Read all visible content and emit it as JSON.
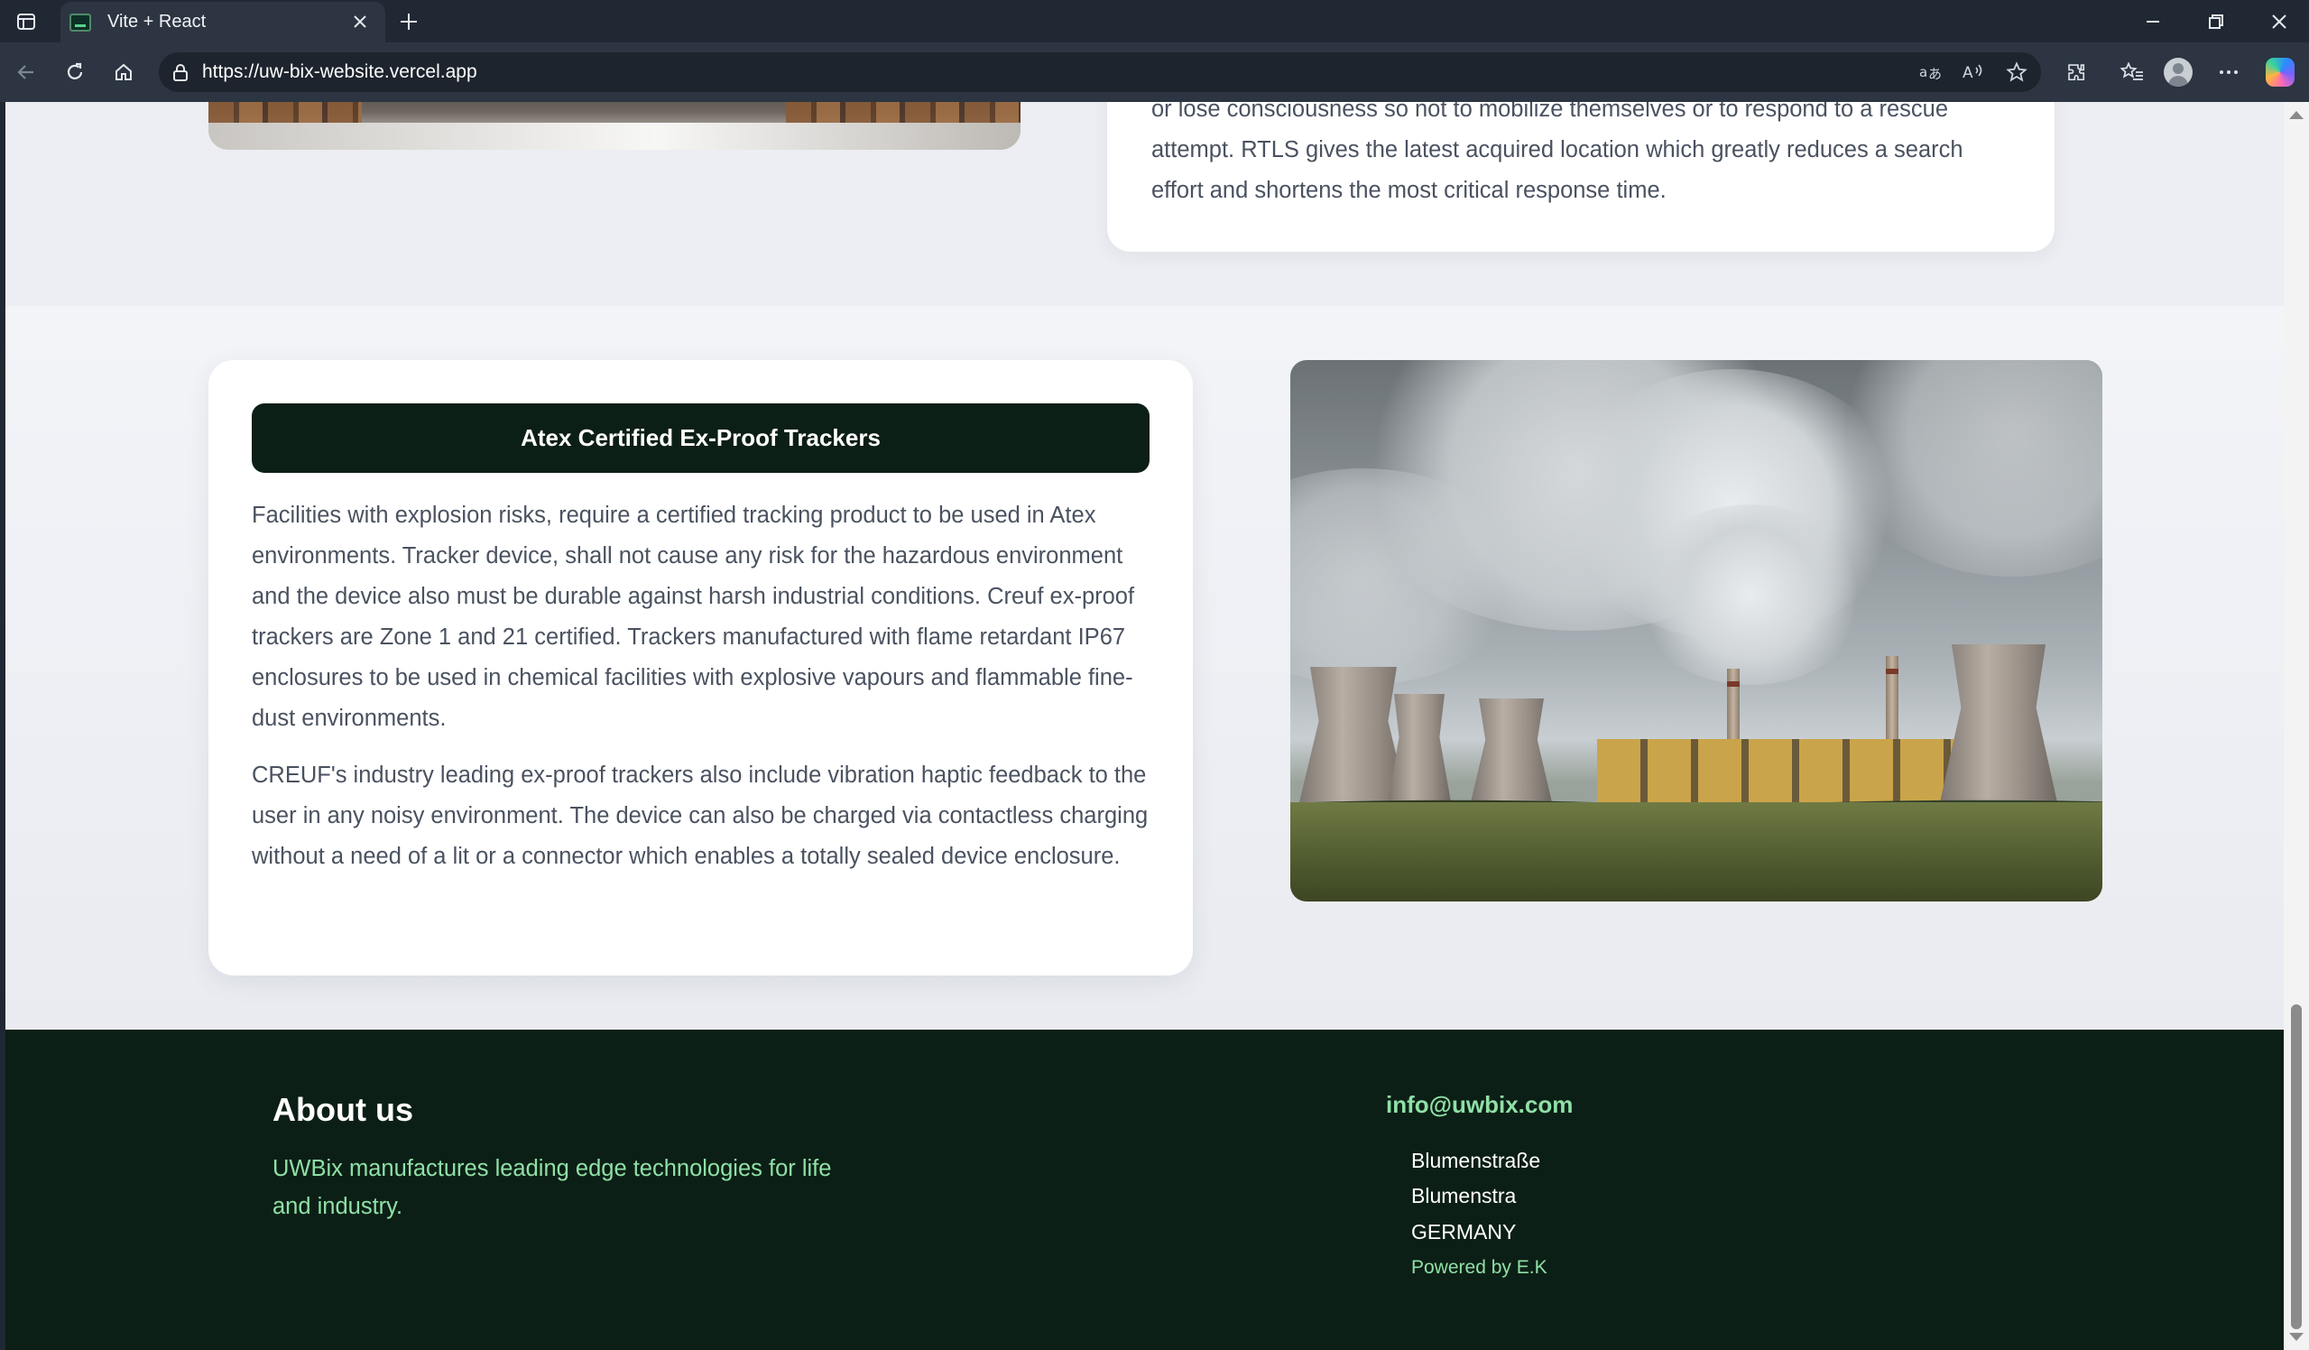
{
  "browser": {
    "tab_title": "Vite + React",
    "url": "https://uw-bix-website.vercel.app",
    "icons": [
      "tab-actions-icon",
      "close-icon",
      "new-tab-icon",
      "minimize-icon",
      "restore-icon",
      "close-window-icon",
      "back-icon",
      "refresh-icon",
      "home-icon",
      "lock-icon",
      "translate-icon",
      "read-aloud-icon",
      "favorite-star-icon",
      "extensions-icon",
      "favorites-icon",
      "profile-avatar",
      "more-icon",
      "copilot-icon"
    ]
  },
  "rtls": {
    "text": "or lose consciousness so not to mobilize themselves or to respond to a rescue attempt. RTLS gives the latest acquired location which greatly reduces a search effort and shortens the most critical response time."
  },
  "atex": {
    "title": "Atex Certified Ex-Proof Trackers",
    "paragraph1": "Facilities with explosion risks, require a certified tracking product to be used in Atex environments. Tracker device, shall not cause any risk for the hazardous environment and the device also must be durable against harsh industrial conditions. Creuf ex-proof trackers are Zone 1 and 21 certified. Trackers manufactured with flame retardant IP67 enclosures to be used in chemical facilities with explosive vapours and flammable fine-dust environments.",
    "paragraph2": "CREUF's industry leading ex-proof trackers also include vibration haptic feedback to the user in any noisy environment. The device can also be charged via contactless charging without a need of a lit or a connector which enables a totally sealed device enclosure."
  },
  "footer": {
    "about_title": "About us",
    "about_text": "UWBix manufactures leading edge technologies for life and industry.",
    "email": "info@uwbix.com",
    "address": [
      "Blumenstraße",
      "Blumenstra",
      "GERMANY"
    ],
    "powered_by": "Powered by E.K"
  },
  "colors": {
    "footer_bg": "#0c1f16",
    "accent_green": "#8fe0a6",
    "title_bar_bg": "#0c1f16",
    "body_text": "#4a5260",
    "page_bg": "#f0f1f5"
  }
}
